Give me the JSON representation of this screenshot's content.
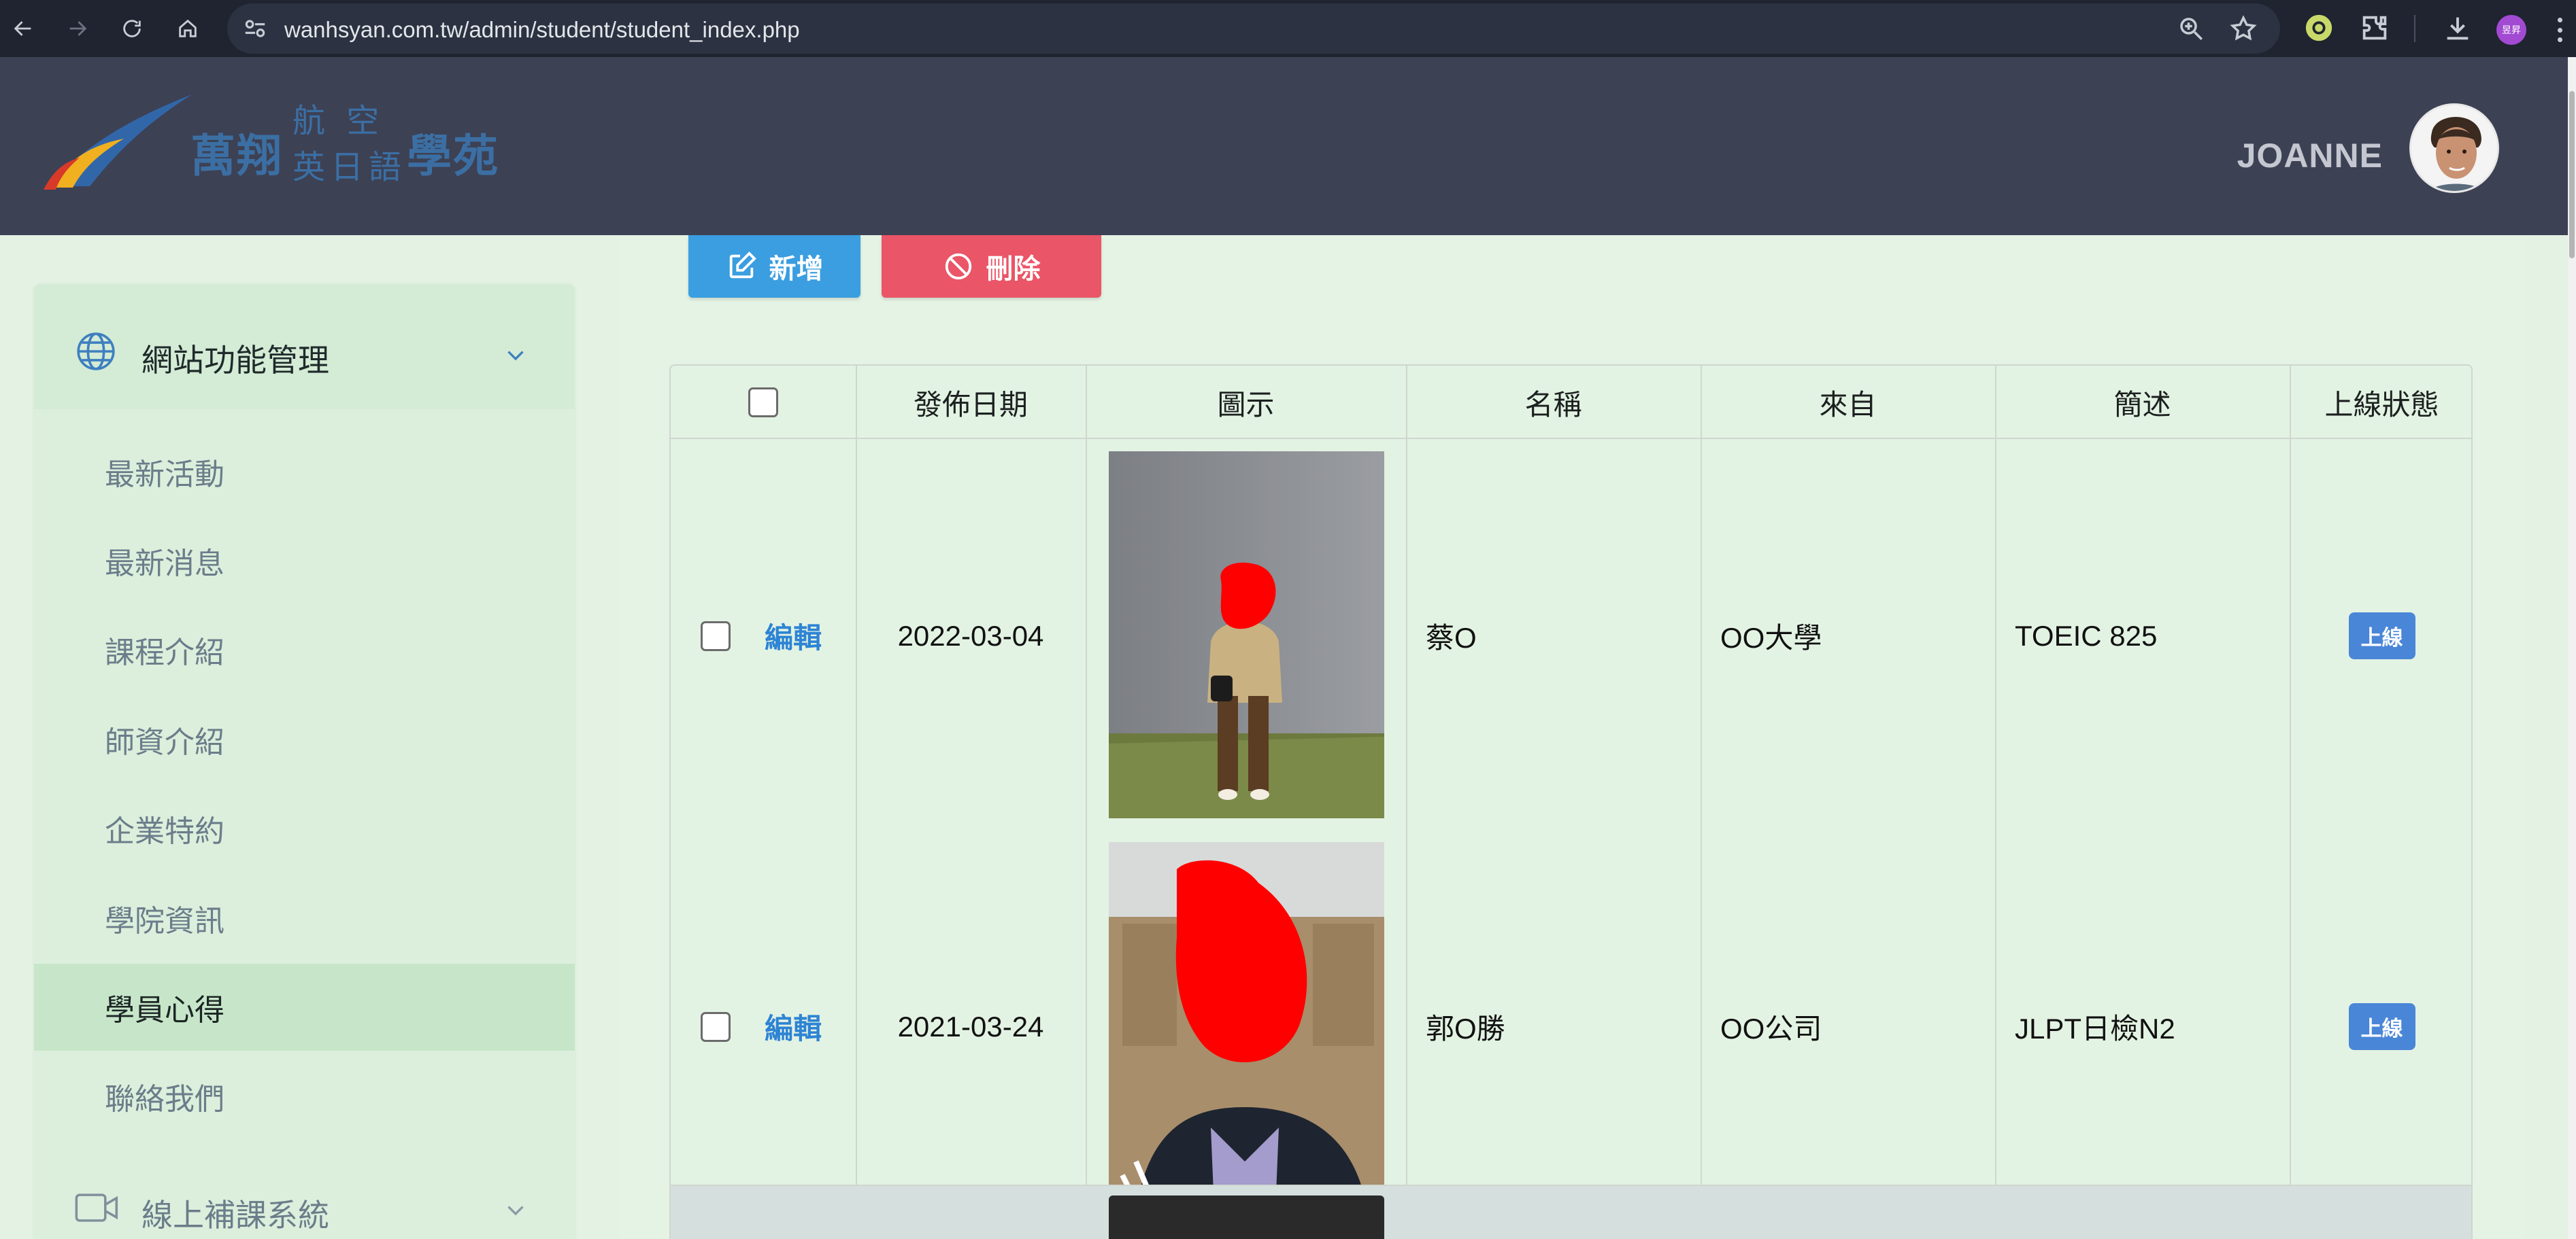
{
  "browser": {
    "url": "wanhsyan.com.tw/admin/student/student_index.php",
    "profile_initials": "昱昇"
  },
  "header": {
    "logo_main": "萬翔",
    "logo_line1": "航 空",
    "logo_line2": "英日語",
    "logo_suffix": "學苑",
    "user_name": "JOANNE"
  },
  "sidebar": {
    "section_label": "網站功能管理",
    "items": [
      {
        "label": "最新活動",
        "active": false
      },
      {
        "label": "最新消息",
        "active": false
      },
      {
        "label": "課程介紹",
        "active": false
      },
      {
        "label": "師資介紹",
        "active": false
      },
      {
        "label": "企業特約",
        "active": false
      },
      {
        "label": "學院資訊",
        "active": false
      },
      {
        "label": "學員心得",
        "active": true
      },
      {
        "label": "聯絡我們",
        "active": false
      }
    ],
    "section2_label": "線上補課系統"
  },
  "toolbar": {
    "add_label": "新增",
    "delete_label": "刪除"
  },
  "table": {
    "headers": [
      "發佈日期",
      "圖示",
      "名稱",
      "來自",
      "簡述",
      "上線狀態"
    ],
    "edit_label": "編輯",
    "rows": [
      {
        "date": "2022-03-04",
        "name": "蔡O",
        "from": "OO大學",
        "summary": "TOEIC 825",
        "status": "上線"
      },
      {
        "date": "2021-03-24",
        "name": "郭O勝",
        "from": "OO公司",
        "summary": "JLPT日檢N2",
        "status": "上線"
      }
    ]
  },
  "colors": {
    "header_bg": "#3d4154",
    "add_button": "#3a9ee0",
    "delete_button": "#ea5567",
    "status_badge": "#4a86d8",
    "link": "#2e84d4"
  }
}
